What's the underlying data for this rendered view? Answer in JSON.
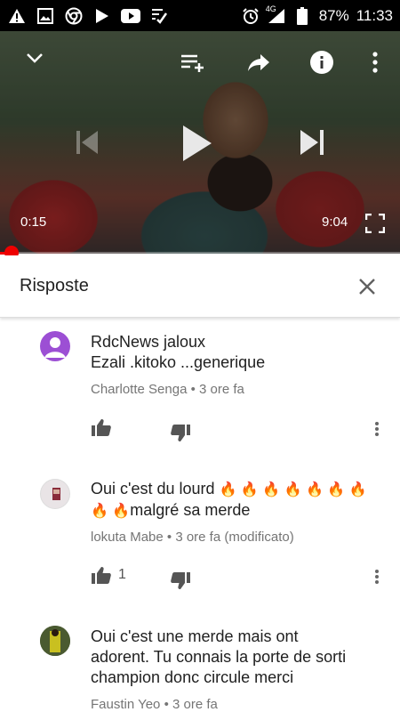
{
  "status_bar": {
    "network": "4G",
    "battery": "87%",
    "time": "11:33"
  },
  "player": {
    "current_time": "0:15",
    "duration": "9:04",
    "progress": 0.028
  },
  "replies": {
    "title": "Risposte"
  },
  "comments": [
    {
      "text_line1": "RdcNews   jaloux",
      "text_line2": "Ezali   .kitoko ...generique",
      "author": "Charlotte Senga",
      "time": "3 ore fa",
      "likes": ""
    },
    {
      "text_line1": "Oui c'est du lourd",
      "text_line2": "malgré sa merde",
      "fires_line1": "🔥 🔥 🔥 🔥 🔥 🔥 🔥",
      "fires_line2": "🔥 🔥",
      "author": "lokuta Mabe",
      "time": "3 ore fa (modificato)",
      "likes": "1"
    },
    {
      "text_line1": "Oui c'est une merde mais ont",
      "text_line2": "adorent. Tu connais la porte de sorti",
      "text_line3": "champion donc circule merci",
      "author": "Faustin Yeo",
      "time": "3 ore fa"
    }
  ],
  "colors": {
    "progress": "#e00000",
    "text": "#212121",
    "meta": "#757575"
  }
}
